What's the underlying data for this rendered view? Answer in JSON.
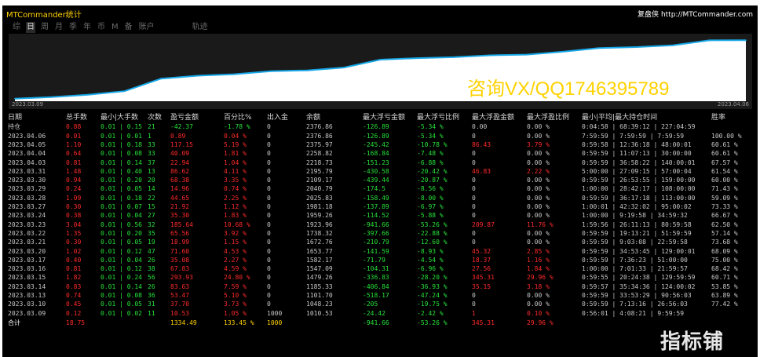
{
  "window": {
    "title": "MTCommander统计",
    "brand_prefix": "复盘侠",
    "brand_url": "http://MTCommander.com"
  },
  "tabs": [
    {
      "label": "综",
      "active": false
    },
    {
      "label": "日",
      "active": true
    },
    {
      "label": "周",
      "active": false
    },
    {
      "label": "月",
      "active": false
    },
    {
      "label": "季",
      "active": false
    },
    {
      "label": "年",
      "active": false
    },
    {
      "label": "币",
      "active": false
    },
    {
      "label": "M",
      "active": false
    },
    {
      "label": "备",
      "active": false
    },
    {
      "label": "账户",
      "active": false
    },
    {
      "label": "轨迹",
      "active": false
    }
  ],
  "chart": {
    "start_label": "2023.03.09",
    "end_label": "2023.04.06",
    "line_color": "#17a8e8",
    "fill_color": "#ffffff",
    "promo_text": "咨询VX/QQ1746395789"
  },
  "chart_data": {
    "type": "area",
    "x": [
      "2023.03.09",
      "2023.03.10",
      "2023.03.13",
      "2023.03.14",
      "2023.03.15",
      "2023.03.16",
      "2023.03.17",
      "2023.03.20",
      "2023.03.21",
      "2023.03.22",
      "2023.03.23",
      "2023.03.24",
      "2023.03.27",
      "2023.03.28",
      "2023.03.29",
      "2023.03.30",
      "2023.03.31",
      "2023.04.03",
      "2023.04.04",
      "2023.04.05",
      "2023.04.06"
    ],
    "values": [
      1010.53,
      1048.23,
      1101.7,
      1185.33,
      1479.26,
      1547.09,
      1582.17,
      1653.77,
      1672.76,
      1738.32,
      1923.96,
      1959.26,
      1981.18,
      2025.83,
      2040.79,
      2109.17,
      2195.79,
      2218.73,
      2258.82,
      2375.97,
      2376.86
    ]
  },
  "columns": [
    "日期",
    "总手数",
    "最小|大手数",
    "次数",
    "盈亏金额",
    "百分比%",
    "出入金",
    "余额",
    "最大浮亏金额",
    "最大浮亏比例",
    "最大浮盈金额",
    "最大浮盈比例",
    "最小|平均|最大持仓时间",
    "胜率"
  ],
  "holding_row": [
    "持仓",
    "0.88",
    "0.01 | 0.15",
    "21",
    "-42.37",
    "-1.78 %",
    "0",
    "2376.86",
    "-126.89",
    "-5.34 %",
    "0.00",
    "0.00 %",
    "0:04:58 | 68:39:12 | 227:04:59",
    ""
  ],
  "rows": [
    [
      "2023.04.06",
      "0.01",
      "0.01 | 0.01",
      "1",
      "0.89",
      "0.04 %",
      "0",
      "2376.86",
      "-126.89",
      "-5.34 %",
      "0",
      "0.00 %",
      "7:59:59 | 7:59:59 | 7:59:59",
      "100.00 %"
    ],
    [
      "2023.04.05",
      "1.10",
      "0.01 | 0.18",
      "33",
      "117.15",
      "5.19 %",
      "0",
      "2375.97",
      "-245.42",
      "-10.78 %",
      "86.43",
      "3.79 %",
      "0:59:58 | 12:36:18 | 48:00:01",
      "60.61 %"
    ],
    [
      "2023.04.04",
      "0.64",
      "0.01 | 0.08",
      "33",
      "40.09",
      "1.81 %",
      "0",
      "2258.82",
      "-168.84",
      "-7.48 %",
      "0",
      "0.00 %",
      "0:59:59 | 11:07:13 | 30:00:00",
      "60.61 %"
    ],
    [
      "2023.04.03",
      "0.81",
      "0.01 | 0.14",
      "37",
      "22.94",
      "1.04 %",
      "0",
      "2218.73",
      "-151.23",
      "-6.88 %",
      "0",
      "0.00 %",
      "0:59:59 | 36:58:22 | 140:00:01",
      "67.57 %"
    ],
    [
      "2023.03.31",
      "1.48",
      "0.01 | 0.40",
      "13",
      "86.62",
      "4.11 %",
      "0",
      "2195.79",
      "-430.58",
      "-20.42 %",
      "46.83",
      "2.22 %",
      "5:00:00 | 27:09:15 | 57:00:04",
      "61.54 %"
    ],
    [
      "2023.03.30",
      "0.94",
      "0.01 | 0.20",
      "20",
      "68.38",
      "3.35 %",
      "0",
      "2109.17",
      "-439.44",
      "-20.87 %",
      "0",
      "0.00 %",
      "0:59:59 | 26:53:55 | 159:00:00",
      "60.00 %"
    ],
    [
      "2023.03.29",
      "0.24",
      "0.01 | 0.05",
      "14",
      "14.96",
      "0.74 %",
      "0",
      "2040.79",
      "-174.5",
      "-8.56 %",
      "0",
      "0.00 %",
      "1:00:00 | 28:42:17 | 108:00:00",
      "71.43 %"
    ],
    [
      "2023.03.28",
      "1.09",
      "0.01 | 0.18",
      "22",
      "44.65",
      "2.25 %",
      "0",
      "2025.83",
      "-158.49",
      "-8.00 %",
      "0",
      "0.00 %",
      "0:59:59 | 36:17:18 | 113:00:00",
      "59.09 %"
    ],
    [
      "2023.03.27",
      "0.30",
      "0.01 | 0.07",
      "15",
      "21.92",
      "1.12 %",
      "0",
      "1981.18",
      "-137.89",
      "-6.97 %",
      "0",
      "0.00 %",
      "1:00:01 | 42:32:02 | 95:00:02",
      "73.33 %"
    ],
    [
      "2023.03.24",
      "0.38",
      "0.01 | 0.04",
      "27",
      "35.30",
      "1.83 %",
      "0",
      "1959.26",
      "-114.52",
      "-5.88 %",
      "0",
      "0.00 %",
      "1:00:00 | 9:19:58 | 34:59:32",
      "66.67 %"
    ],
    [
      "2023.03.23",
      "3.04",
      "0.01 | 0.56",
      "32",
      "185.64",
      "10.68 %",
      "0",
      "1923.96",
      "-941.66",
      "-53.26 %",
      "209.87",
      "11.76 %",
      "1:59:56 | 26:11:13 | 80:59:58",
      "62.50 %"
    ],
    [
      "2023.03.22",
      "1.35",
      "0.01 | 0.20",
      "35",
      "65.56",
      "3.92 %",
      "0",
      "1738.32",
      "-397.66",
      "-22.88 %",
      "0",
      "0.00 %",
      "0:59:59 | 19:13:21 | 51:59:59",
      "57.14 %"
    ],
    [
      "2023.03.21",
      "0.30",
      "0.01 | 0.05",
      "19",
      "18.99",
      "1.15 %",
      "0",
      "1672.76",
      "-210.79",
      "-12.60 %",
      "0",
      "0.00 %",
      "0:59:59 | 9:03:08 | 22:59:58",
      "73.68 %"
    ],
    [
      "2023.03.20",
      "1.02",
      "0.01 | 0.12",
      "47",
      "71.60",
      "4.53 %",
      "0",
      "1653.77",
      "-141.59",
      "-8.93 %",
      "45.32",
      "2.85 %",
      "0:59:59 | 34:53:45 | 129:00:01",
      "68.09 %"
    ],
    [
      "2023.03.17",
      "0.40",
      "0.01 | 0.04",
      "26",
      "35.08",
      "2.27 %",
      "0",
      "1582.17",
      "-71.79",
      "-4.54 %",
      "18.37",
      "1.16 %",
      "0:59:59 | 7:36:23 | 51:00:00",
      "75.00 %"
    ],
    [
      "2023.03.16",
      "0.81",
      "0.01 | 0.12",
      "38",
      "67.83",
      "4.59 %",
      "0",
      "1547.09",
      "-104.31",
      "-6.96 %",
      "27.56",
      "1.84 %",
      "1:00:00 | 7:01:33 | 21:59:57",
      "68.42 %"
    ],
    [
      "2023.03.15",
      "1.82",
      "0.01 | 0.24",
      "56",
      "293.93",
      "24.80 %",
      "0",
      "1479.26",
      "-336.83",
      "-28.20 %",
      "345.31",
      "29.96 %",
      "0:59:55 | 20:24:38 | 129:59:59",
      "60.71 %"
    ],
    [
      "2023.03.14",
      "0.83",
      "0.01 | 0.14",
      "26",
      "83.63",
      "7.59 %",
      "0",
      "1185.33",
      "-406.84",
      "-36.93 %",
      "35.15",
      "3.18 %",
      "0:59:57 | 35:34:36 | 124:00:02",
      "53.85 %"
    ],
    [
      "2023.03.13",
      "0.74",
      "0.01 | 0.08",
      "36",
      "53.47",
      "5.10 %",
      "0",
      "1101.70",
      "-518.17",
      "-47.24 %",
      "0",
      "0.00 %",
      "0:59:59 | 33:53:29 | 90:56:03",
      "63.89 %"
    ],
    [
      "2023.03.10",
      "0.45",
      "0.01 | 0.05",
      "31",
      "37.70",
      "3.73 %",
      "0",
      "1048.23",
      "-205",
      "-19.75 %",
      "0",
      "0.00 %",
      "0:59:59 | 7:13:16 | 26:56:03",
      "77.42 %"
    ],
    [
      "2023.03.09",
      "0.12",
      "0.01 | 0.02",
      "11",
      "10.53",
      "1.05 %",
      "1000",
      "1010.53",
      "-24.42",
      "-2.42 %",
      "1",
      "0.10 %",
      "0:56:01 | 4:08:21 | 9:59:59",
      ""
    ]
  ],
  "total_row": [
    "合计",
    "18.75",
    "",
    "",
    "1334.49",
    "133.45 %",
    "1000",
    "",
    "-941.66",
    "-53.26 %",
    "345.31",
    "29.96 %",
    "",
    ""
  ],
  "watermark": "指标铺"
}
